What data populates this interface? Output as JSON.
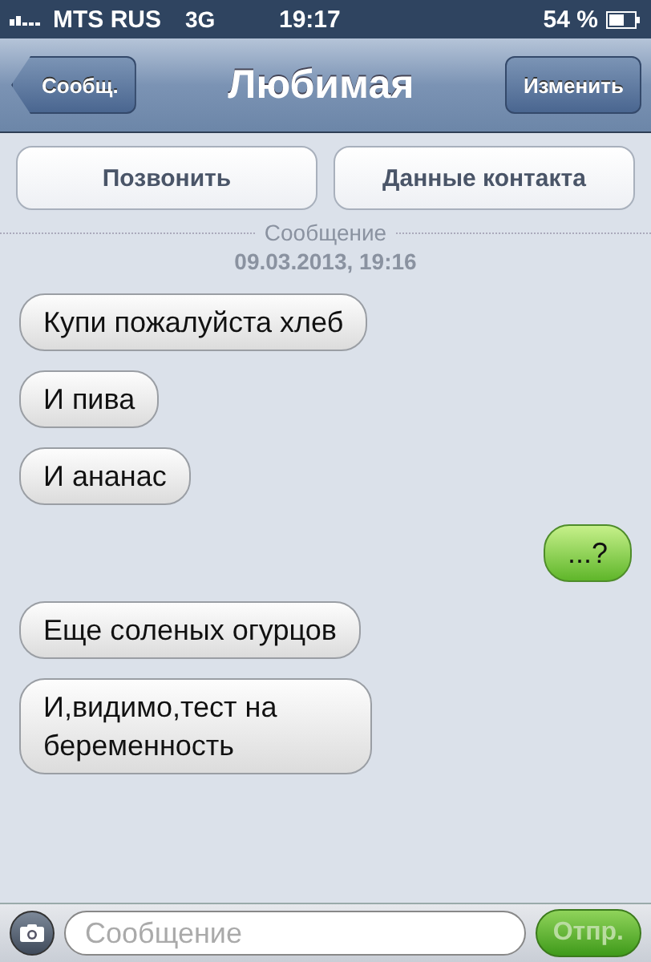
{
  "status_bar": {
    "carrier": "MTS RUS",
    "network": "3G",
    "time": "19:17",
    "battery": "54 %"
  },
  "nav_bar": {
    "back": "Сообщ.",
    "title": "Любимая",
    "edit": "Изменить"
  },
  "actions": [
    "Позвонить",
    "Данные контакта"
  ],
  "separator": {
    "label": "Сообщение",
    "date": "09.03.2013, 19:16"
  },
  "messages": [
    {
      "kind": "incoming",
      "text": "Купи пожалуйста хлеб"
    },
    {
      "kind": "incoming",
      "text": "И пива"
    },
    {
      "kind": "incoming",
      "text": "И ананас"
    },
    {
      "kind": "outgoing",
      "text": "...?"
    },
    {
      "kind": "incoming",
      "text": "Еще соленых огурцов"
    },
    {
      "kind": "incoming",
      "text": "И,видимо,тест на беременность"
    }
  ],
  "composer": {
    "placeholder": "Сообщение",
    "send": "Отпр.",
    "send_disabled": true
  }
}
